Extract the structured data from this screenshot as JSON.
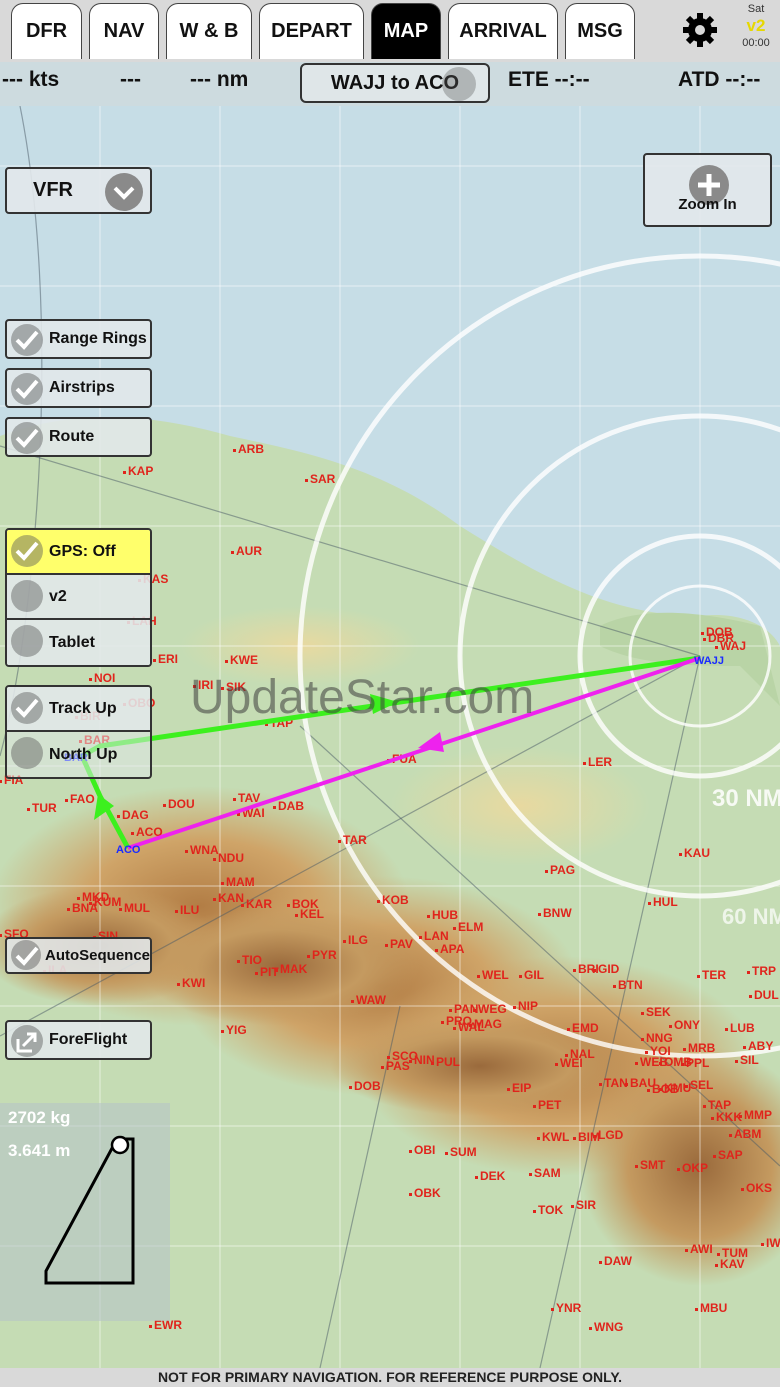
{
  "tabs": [
    {
      "label": "DFR",
      "active": false
    },
    {
      "label": "NAV",
      "active": false
    },
    {
      "label": "W & B",
      "active": false
    },
    {
      "label": "DEPART",
      "active": false
    },
    {
      "label": "MAP",
      "active": true
    },
    {
      "label": "ARRIVAL",
      "active": false
    },
    {
      "label": "MSG",
      "active": false
    }
  ],
  "status": {
    "day": "Sat",
    "version": "v2",
    "time": "00:00"
  },
  "info_bar": {
    "speed": "--- kts",
    "course": "---",
    "distance": "--- nm",
    "route": "WAJJ to ACO",
    "ete": "ETE --:--",
    "atd": "ATD --:--"
  },
  "map_type": {
    "label": "VFR"
  },
  "zoom": {
    "label": "Zoom In"
  },
  "layers": [
    {
      "label": "Range Rings",
      "checked": true
    },
    {
      "label": "Airstrips",
      "checked": true
    },
    {
      "label": "Route",
      "checked": true
    }
  ],
  "gps_group": [
    {
      "label": "GPS: Off",
      "checked": true,
      "highlight": true
    },
    {
      "label": "v2",
      "checked": false
    },
    {
      "label": "Tablet",
      "checked": false
    }
  ],
  "orientation": [
    {
      "label": "Track Up",
      "checked": true
    },
    {
      "label": "North Up",
      "checked": false
    }
  ],
  "autosequence": {
    "label": "AutoSequence",
    "checked": true
  },
  "foreflight": {
    "label": "ForeFlight"
  },
  "weight_balance": {
    "weight": "2702 kg",
    "arm": "3.641 m"
  },
  "range_ring_label": "30 NM",
  "range_ring_label_2": "60 NM",
  "watermark": "UpdateStar.com",
  "footer": "NOT FOR PRIMARY NAVIGATION. FOR REFERENCE PURPOSE ONLY.",
  "airports": [
    {
      "code": "ARB"
    },
    {
      "code": "SAR"
    },
    {
      "code": "KAP"
    },
    {
      "code": "AUR"
    },
    {
      "code": "KAS"
    },
    {
      "code": "LAH"
    },
    {
      "code": "ERI"
    },
    {
      "code": "KWE"
    },
    {
      "code": "NOI"
    },
    {
      "code": "IRI"
    },
    {
      "code": "SIK"
    },
    {
      "code": "OBO"
    },
    {
      "code": "BIR"
    },
    {
      "code": "TAP"
    },
    {
      "code": "BAR"
    },
    {
      "code": "FIA"
    },
    {
      "code": "FAO"
    },
    {
      "code": "TUR"
    },
    {
      "code": "DAG"
    },
    {
      "code": "DOU"
    },
    {
      "code": "TAV"
    },
    {
      "code": "WAI"
    },
    {
      "code": "DAB"
    },
    {
      "code": "ACO"
    },
    {
      "code": "FUA"
    },
    {
      "code": "LER"
    },
    {
      "code": "TAR"
    },
    {
      "code": "WNA"
    },
    {
      "code": "NDU"
    },
    {
      "code": "KAU"
    },
    {
      "code": "MAM"
    },
    {
      "code": "KAN"
    },
    {
      "code": "KAR"
    },
    {
      "code": "BOK"
    },
    {
      "code": "KEL"
    },
    {
      "code": "KOB"
    },
    {
      "code": "PAG"
    },
    {
      "code": "MKD"
    },
    {
      "code": "KUM"
    },
    {
      "code": "BNA"
    },
    {
      "code": "MUL"
    },
    {
      "code": "ILU"
    },
    {
      "code": "HUB"
    },
    {
      "code": "BNW"
    },
    {
      "code": "HUL"
    },
    {
      "code": "ELM"
    },
    {
      "code": "SIN"
    },
    {
      "code": "ILG"
    },
    {
      "code": "PAV"
    },
    {
      "code": "LAN"
    },
    {
      "code": "APA"
    },
    {
      "code": "SFO"
    },
    {
      "code": "PYR"
    },
    {
      "code": "TIO"
    },
    {
      "code": "PIT"
    },
    {
      "code": "MAK"
    },
    {
      "code": "ILA"
    },
    {
      "code": "KWI"
    },
    {
      "code": "WEL"
    },
    {
      "code": "GIL"
    },
    {
      "code": "BRI"
    },
    {
      "code": "GID"
    },
    {
      "code": "TER"
    },
    {
      "code": "TRP"
    },
    {
      "code": "BTN"
    },
    {
      "code": "DUL"
    },
    {
      "code": "WAW"
    },
    {
      "code": "PAN"
    },
    {
      "code": "WEG"
    },
    {
      "code": "NIP"
    },
    {
      "code": "SEK"
    },
    {
      "code": "YIG"
    },
    {
      "code": "PRO"
    },
    {
      "code": "WAL"
    },
    {
      "code": "MAG"
    },
    {
      "code": "EMD"
    },
    {
      "code": "ONY"
    },
    {
      "code": "LUB"
    },
    {
      "code": "NNG"
    },
    {
      "code": "YOI"
    },
    {
      "code": "MRB"
    },
    {
      "code": "ABY"
    },
    {
      "code": "WEB"
    },
    {
      "code": "PAS"
    },
    {
      "code": "SCO"
    },
    {
      "code": "NIN"
    },
    {
      "code": "PUL"
    },
    {
      "code": "NAL"
    },
    {
      "code": "WEI"
    },
    {
      "code": "OMB"
    },
    {
      "code": "PPL"
    },
    {
      "code": "SIL"
    },
    {
      "code": "DOB"
    },
    {
      "code": "DBR"
    },
    {
      "code": "EIP"
    },
    {
      "code": "TAN"
    },
    {
      "code": "BAU"
    },
    {
      "code": "BOB"
    },
    {
      "code": "KMU"
    },
    {
      "code": "SEL"
    },
    {
      "code": "PET"
    },
    {
      "code": "TAP"
    },
    {
      "code": "KWL"
    },
    {
      "code": "BIM"
    },
    {
      "code": "LGD"
    },
    {
      "code": "KKK"
    },
    {
      "code": "MMP"
    },
    {
      "code": "ABM"
    },
    {
      "code": "OBI"
    },
    {
      "code": "SUM"
    },
    {
      "code": "SAP"
    },
    {
      "code": "DEK"
    },
    {
      "code": "SMT"
    },
    {
      "code": "OKP"
    },
    {
      "code": "SAM"
    },
    {
      "code": "OBK"
    },
    {
      "code": "OKS"
    },
    {
      "code": "TOK"
    },
    {
      "code": "SIR"
    },
    {
      "code": "AWI"
    },
    {
      "code": "TUM"
    },
    {
      "code": "KAV"
    },
    {
      "code": "IWA"
    },
    {
      "code": "DAW"
    },
    {
      "code": "YNR"
    },
    {
      "code": "MBU"
    },
    {
      "code": "WNG"
    },
    {
      "code": "EWR"
    },
    {
      "code": "WAJ"
    },
    {
      "code": "DOB"
    }
  ],
  "waypoints": {
    "origin": "WAJJ",
    "destination": "ACO",
    "alternate": "BAR"
  },
  "colors": {
    "route_out": "#3cf01e",
    "route_back": "#ee22ee",
    "airport": "#e0241c",
    "gps_highlight": "#ffff6b"
  }
}
